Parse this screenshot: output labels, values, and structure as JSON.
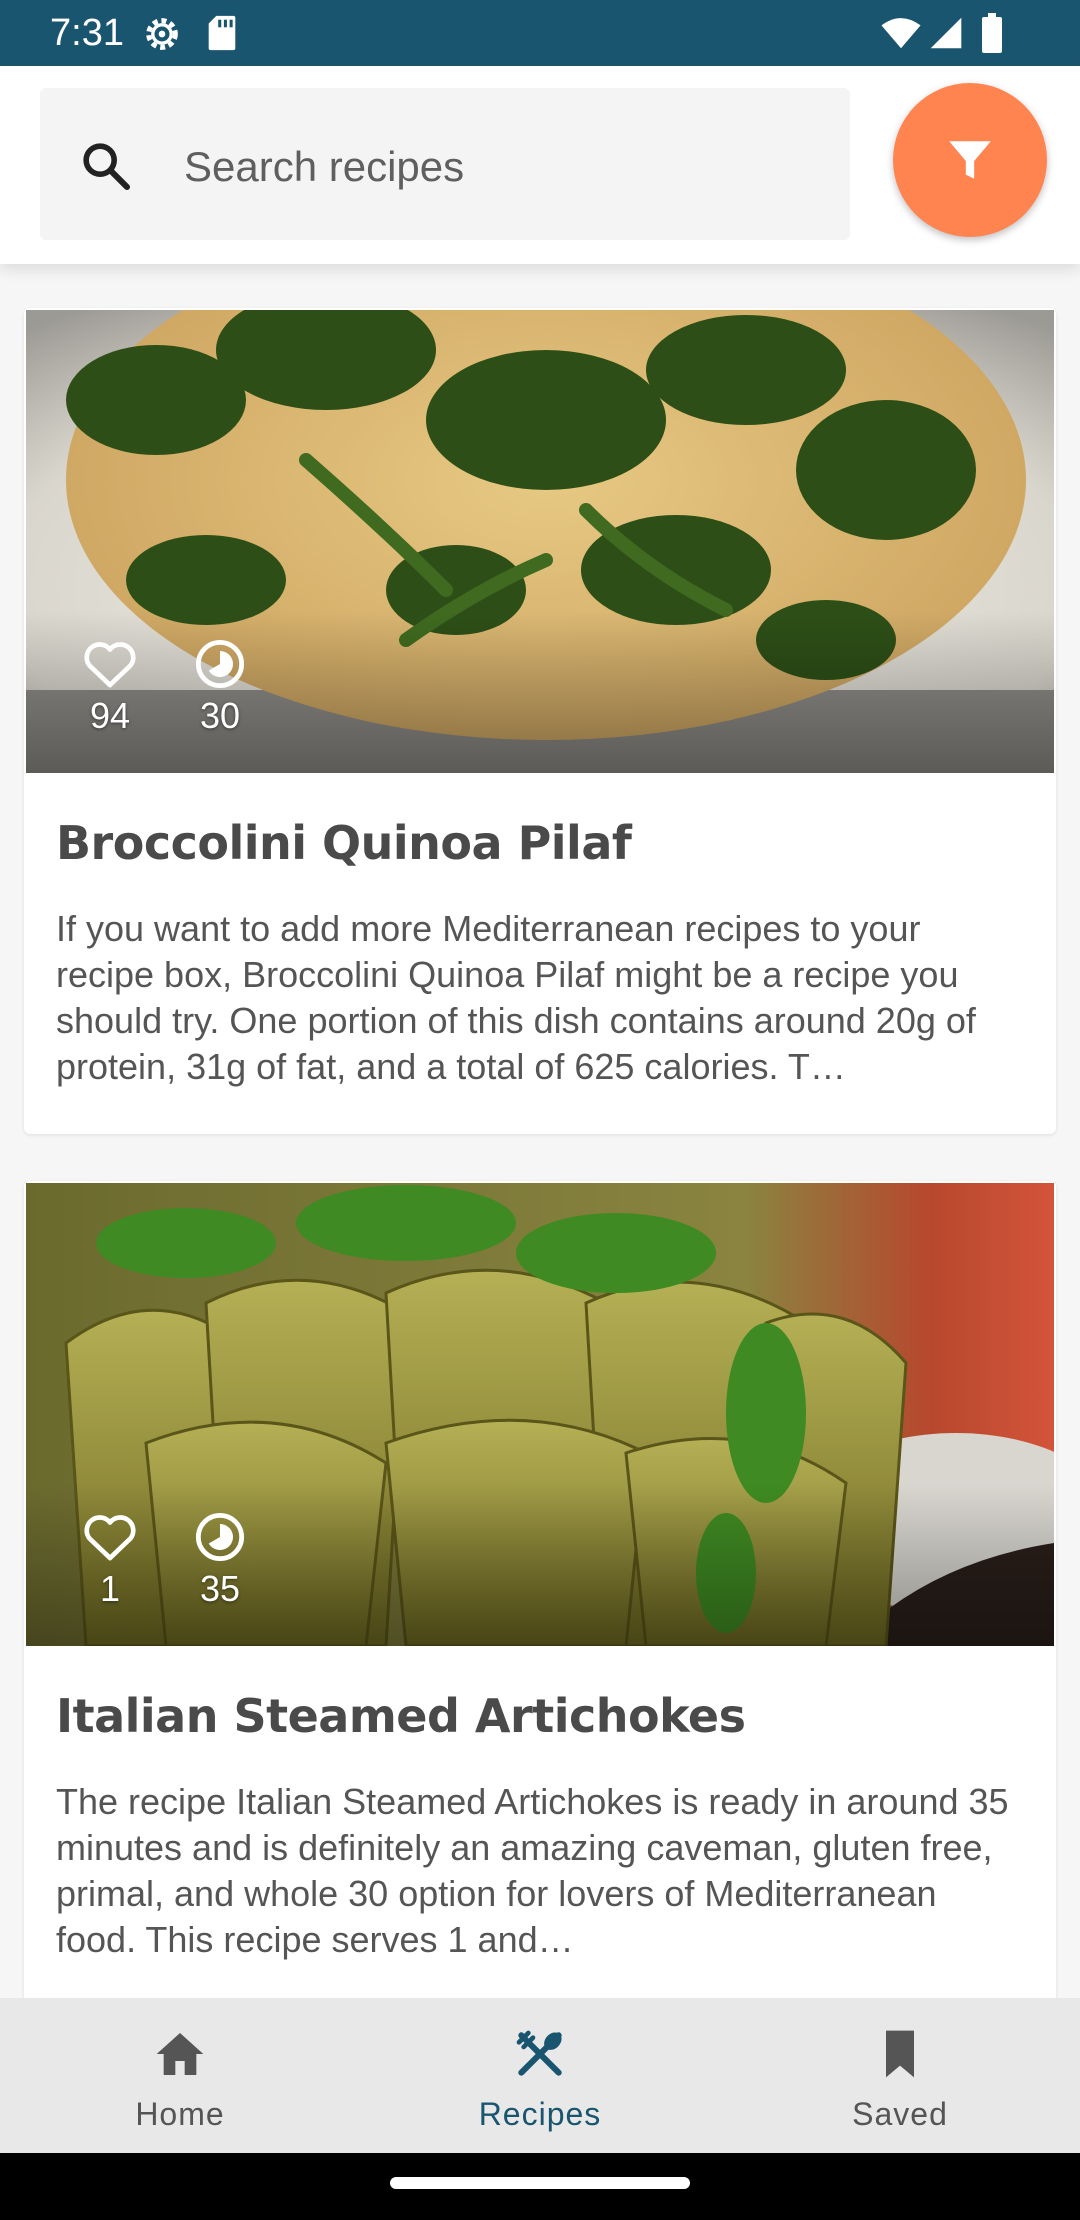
{
  "status_bar": {
    "time": "7:31",
    "icons": [
      "gear-icon",
      "sd-card-icon",
      "wifi-icon",
      "signal-icon",
      "battery-icon"
    ],
    "background": "#1a5570"
  },
  "search": {
    "placeholder": "Search recipes",
    "value": ""
  },
  "filter_button": {
    "icon": "filter-icon",
    "color": "#ff8450"
  },
  "recipes": [
    {
      "title": "Broccolini Quinoa Pilaf",
      "likes": "94",
      "minutes": "30",
      "description": "If you want to add more Mediterranean recipes to your recipe box, Broccolini Quinoa Pilaf might be a recipe you should try. One portion of this dish contains around 20g of protein, 31g of fat, and a total of 625 calories. T…"
    },
    {
      "title": "Italian Steamed Artichokes",
      "likes": "1",
      "minutes": "35",
      "description": "The recipe Italian Steamed Artichokes is ready in around 35 minutes and is definitely an amazing caveman, gluten free, primal, and whole 30 option for lovers of Mediterranean food. This recipe serves 1 and…"
    }
  ],
  "bottom_nav": {
    "items": [
      {
        "label": "Home",
        "icon": "home-icon",
        "active": false
      },
      {
        "label": "Recipes",
        "icon": "fork-knife-icon",
        "active": true
      },
      {
        "label": "Saved",
        "icon": "bookmark-icon",
        "active": false
      }
    ],
    "active_color": "#1a5570"
  }
}
